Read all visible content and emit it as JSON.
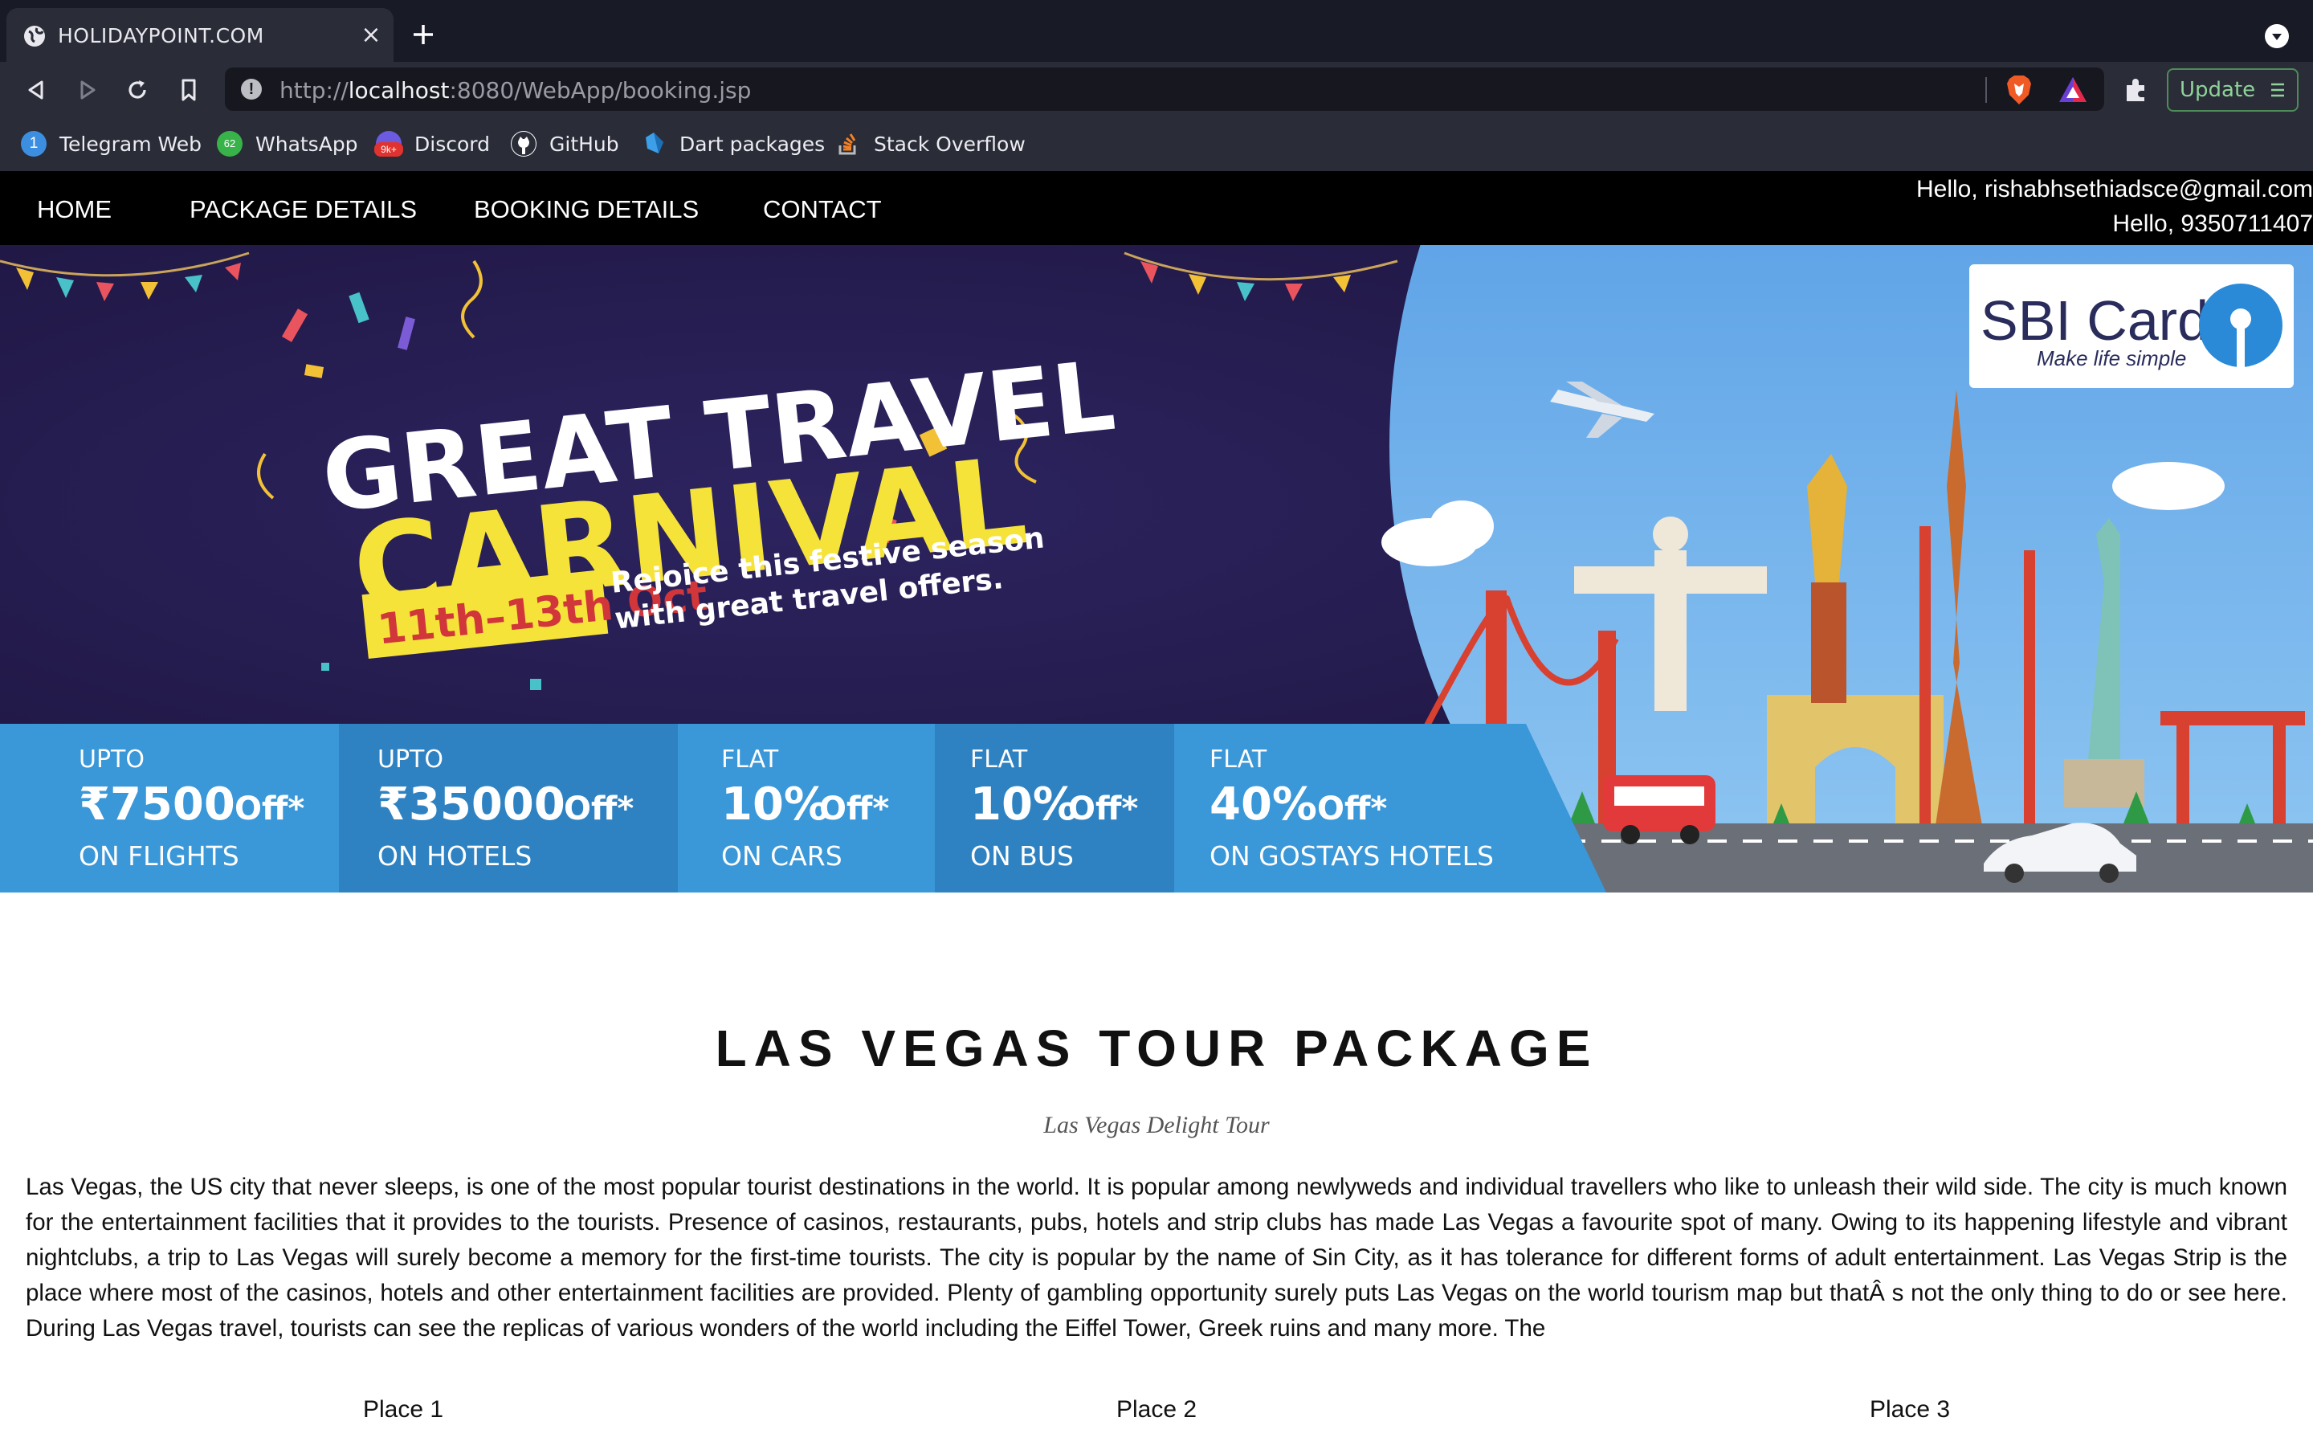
{
  "browser": {
    "tab_title": "HOLIDAYPOINT.COM",
    "url_scheme": "http://",
    "url_host": "localhost",
    "url_rest": ":8080/WebApp/booking.jsp",
    "update_label": "Update",
    "bookmarks": [
      {
        "label": "Telegram Web",
        "icon": "telegram-icon",
        "badge": "1"
      },
      {
        "label": "WhatsApp",
        "icon": "whatsapp-icon",
        "badge": "62"
      },
      {
        "label": "Discord",
        "icon": "discord-icon",
        "badge": "9k+"
      },
      {
        "label": "GitHub",
        "icon": "github-icon"
      },
      {
        "label": "Dart packages",
        "icon": "dart-icon"
      },
      {
        "label": "Stack Overflow",
        "icon": "stackoverflow-icon"
      }
    ]
  },
  "nav": {
    "items": [
      "HOME",
      "PACKAGE DETAILS",
      "BOOKING DETAILS",
      "CONTACT"
    ],
    "greeting_email": "Hello, rishabhsethiadsce@gmail.com",
    "greeting_phone": "Hello, 9350711407"
  },
  "banner": {
    "headline_1": "GREAT TRAVEL",
    "headline_2": "CARNIVAL",
    "dates": "11th–13th Oct",
    "tagline_1": "Rejoice this festive season",
    "tagline_2": "with great travel offers.",
    "brand": "SBI Card",
    "brand_tagline": "Make life simple",
    "offers": [
      {
        "prefix": "UPTO",
        "amount": "₹7500",
        "suffix": "Off*",
        "target": "ON FLIGHTS"
      },
      {
        "prefix": "UPTO",
        "amount": "₹35000",
        "suffix": "Off*",
        "target": "ON HOTELS"
      },
      {
        "prefix": "FLAT",
        "amount": "10%",
        "suffix": "Off*",
        "target": "ON CARS"
      },
      {
        "prefix": "FLAT",
        "amount": "10%",
        "suffix": "Off*",
        "target": "ON BUS"
      },
      {
        "prefix": "FLAT",
        "amount": "40%",
        "suffix": "Off*",
        "target": "ON GOSTAYS HOTELS"
      }
    ]
  },
  "package": {
    "title": "LAS VEGAS TOUR PACKAGE",
    "subtitle": "Las Vegas Delight Tour",
    "description": "Las Vegas, the US city that never sleeps, is one of the most popular tourist destinations in the world. It is popular among newlyweds and individual travellers who like to unleash their wild side. The city is much known for the entertainment facilities that it provides to the tourists. Presence of casinos, restaurants, pubs, hotels and strip clubs has made Las Vegas a favourite spot of many. Owing to its happening lifestyle and vibrant nightclubs, a trip to Las Vegas will surely become a memory for the first-time tourists. The city is popular by the name of Sin City, as it has tolerance for different forms of adult entertainment. Las Vegas Strip is the place where most of the casinos, hotels and other entertainment facilities are provided. Plenty of gambling opportunity surely puts Las Vegas on the world tourism map but thatÂ   s not the only thing to do or see here. During Las Vegas travel, tourists can see the replicas of various wonders of the world including the Eiffel Tower, Greek ruins and many more. The",
    "places": [
      "Place 1",
      "Place 2",
      "Place 3"
    ]
  },
  "colors": {
    "banner_dark": "#241a4a",
    "offer_blue": "#3a97d8",
    "offer_blue_dark": "#2f82c2",
    "headline_yellow": "#f6e33a"
  }
}
